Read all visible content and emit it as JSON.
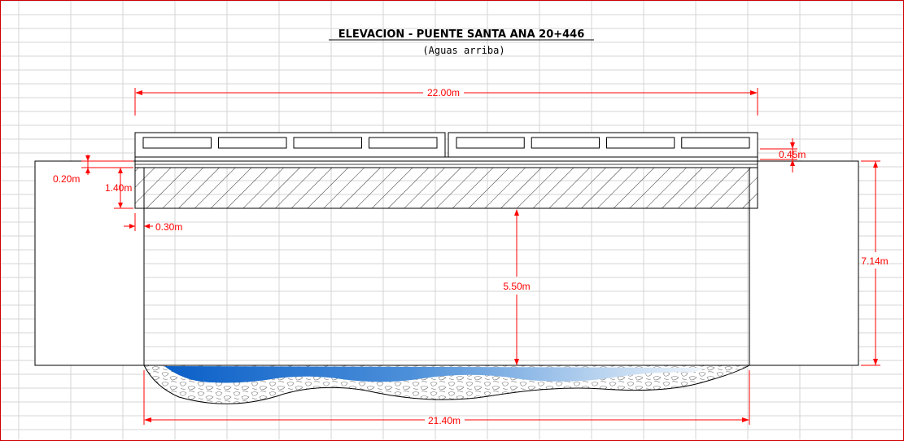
{
  "drawing": {
    "title": "ELEVACION - PUENTE SANTA ANA 20+446",
    "subtitle": "(Aguas arriba)"
  },
  "dimensions": {
    "deck_length": "22.00m",
    "railing_height": "0.45m",
    "slab_top": "0.20m",
    "beam_depth": "1.40m",
    "bearing_offset": "0.30m",
    "clearance": "5.50m",
    "abutment_height": "7.14m",
    "span": "21.40m"
  },
  "colors": {
    "dimension": "#ff0000",
    "line": "#000000",
    "grid": "#d4d4d4",
    "border": "#cc0000",
    "water_dark": "#0a5fc8",
    "water_light": "#eaf2fb"
  }
}
